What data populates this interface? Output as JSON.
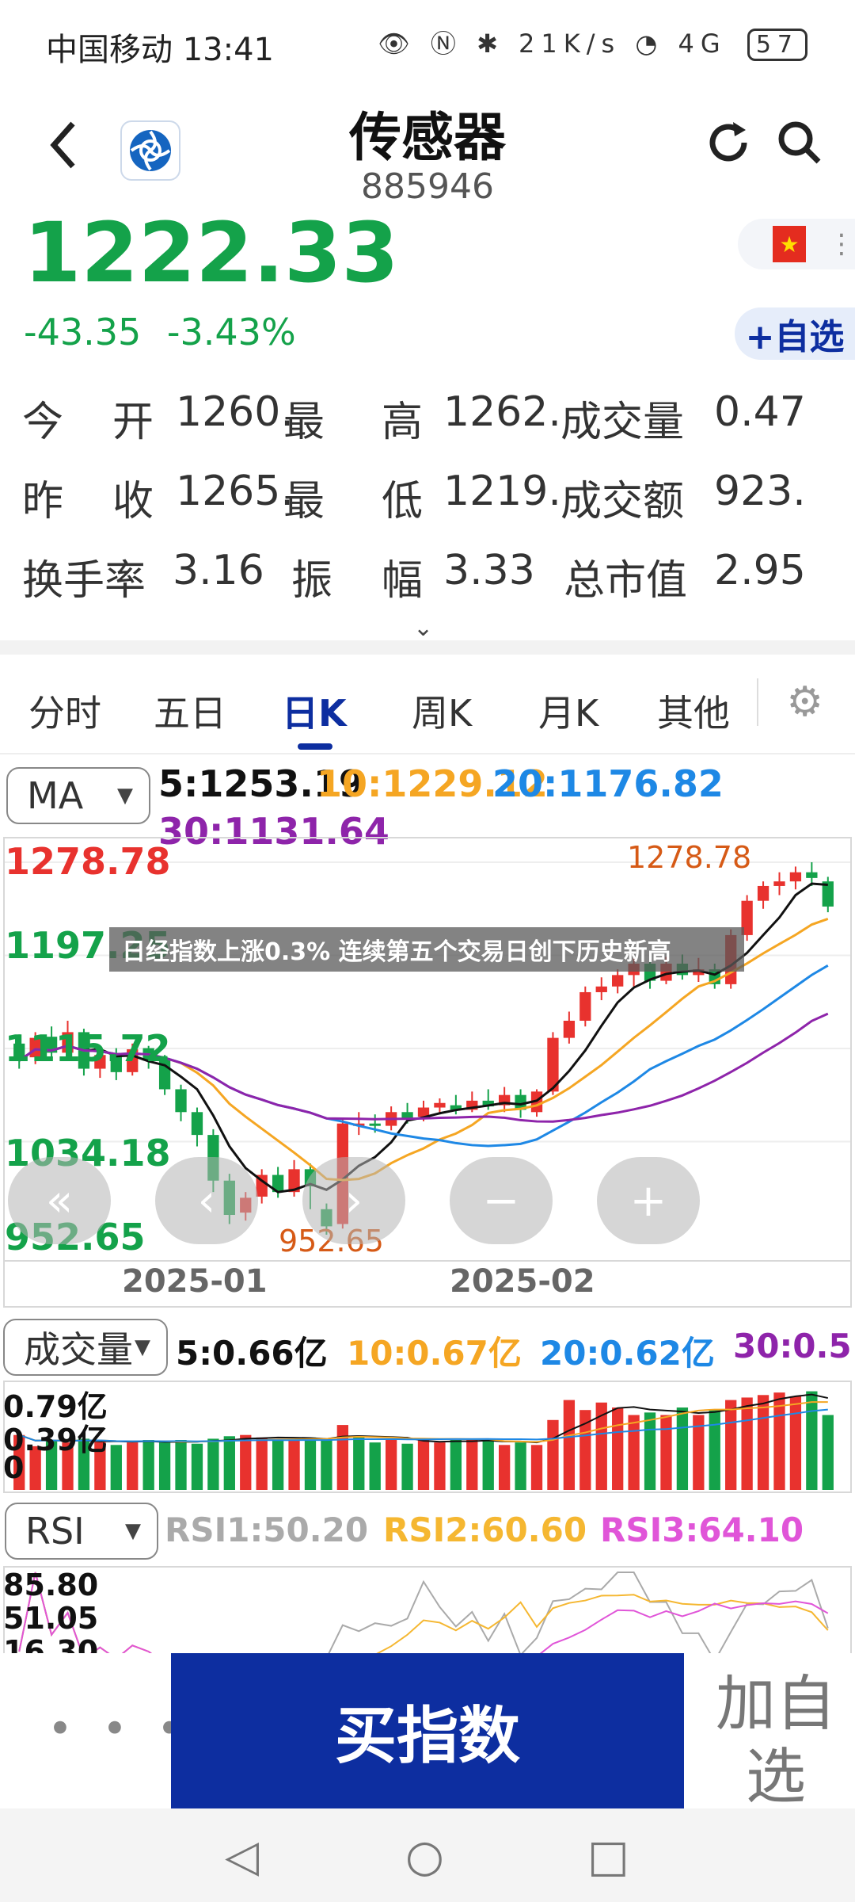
{
  "status": {
    "carrier_time": "中国移动 13:41",
    "icons": "👁 Ⓝ ✱ 21K/s ◔ 4G",
    "battery": "57"
  },
  "header": {
    "title": "传感器",
    "code": "885946",
    "back_icon": "chevron-left",
    "refresh_icon": "refresh",
    "search_icon": "search"
  },
  "quote": {
    "price": "1222.33",
    "change": "-43.35",
    "change_pct": "-3.43%",
    "add_watch": "+自选"
  },
  "stats": {
    "rows": [
      [
        "今",
        "开",
        "1260.",
        "最",
        "高",
        "1262.",
        "成交量",
        "0.47"
      ],
      [
        "昨",
        "收",
        "1265.",
        "最",
        "低",
        "1219.",
        "成交额",
        "923."
      ],
      [
        "换手率",
        "",
        "3.16",
        "振",
        "幅",
        "3.33",
        "总市值",
        "2.95"
      ]
    ]
  },
  "tabs": [
    "分时",
    "五日",
    "日K",
    "周K",
    "月K",
    "其他"
  ],
  "active_tab": "日K",
  "ma": {
    "selector": "MA",
    "ma5": "5:1253.19",
    "ma10": "10:1229.12",
    "ma20": "20:1176.82",
    "ma30": "30:1131.64"
  },
  "price_axis": {
    "p1": "1278.78",
    "p2": "1197.25",
    "p3": "1115.72",
    "p4": "1034.18",
    "p5": "952.65",
    "high_mark": "1278.78",
    "low_mark": "952.65"
  },
  "dates": {
    "d1": "2025-01",
    "d2": "2025-02"
  },
  "news_banner": "日经指数上涨0.3% 连续第五个交易日创下历史新高",
  "volume": {
    "selector": "成交量",
    "v5": "5:0.66亿",
    "v10": "10:0.67亿",
    "v20": "20:0.62亿",
    "v30": "30:0.5",
    "ax1": "0.79亿",
    "ax2": "0.39亿",
    "ax3": "0"
  },
  "rsi": {
    "selector": "RSI",
    "rsi1": "RSI1:50.20",
    "rsi2": "RSI2:60.60",
    "rsi3": "RSI3:64.10",
    "ax1": "85.80",
    "ax2": "51.05",
    "ax3": "16.30"
  },
  "bottom": {
    "more": "• • •",
    "buy": "买指数",
    "add": "加自选"
  },
  "colors": {
    "up": "#e8322e",
    "down": "#14a24a",
    "ma5": "#111111",
    "ma10": "#f5a623",
    "ma20": "#1e88e5",
    "ma30": "#8e24aa",
    "brand": "#0d2ea0"
  },
  "chart_data": {
    "type": "candlestick",
    "ylim": [
      952.65,
      1278.78
    ],
    "candles": [
      [
        1120,
        1105,
        1128,
        1098
      ],
      [
        1108,
        1125,
        1130,
        1102
      ],
      [
        1126,
        1112,
        1135,
        1108
      ],
      [
        1112,
        1130,
        1140,
        1106
      ],
      [
        1130,
        1098,
        1133,
        1092
      ],
      [
        1098,
        1110,
        1115,
        1090
      ],
      [
        1110,
        1095,
        1116,
        1088
      ],
      [
        1095,
        1115,
        1120,
        1092
      ],
      [
        1116,
        1105,
        1118,
        1098
      ],
      [
        1106,
        1080,
        1110,
        1075
      ],
      [
        1080,
        1060,
        1084,
        1052
      ],
      [
        1060,
        1040,
        1064,
        1030
      ],
      [
        1040,
        1000,
        1045,
        990
      ],
      [
        1000,
        970,
        1006,
        962
      ],
      [
        972,
        985,
        990,
        965
      ],
      [
        986,
        1005,
        1010,
        980
      ],
      [
        1005,
        990,
        1012,
        985
      ],
      [
        990,
        1010,
        1018,
        986
      ],
      [
        1010,
        995,
        1015,
        975
      ],
      [
        975,
        960,
        980,
        952.65
      ],
      [
        962,
        1050,
        1055,
        958
      ],
      [
        1050,
        1050,
        1060,
        1040
      ],
      [
        1050,
        1048,
        1058,
        1042
      ],
      [
        1048,
        1060,
        1065,
        1044
      ],
      [
        1060,
        1055,
        1068,
        1050
      ],
      [
        1056,
        1064,
        1070,
        1052
      ],
      [
        1064,
        1068,
        1072,
        1058
      ],
      [
        1066,
        1062,
        1075,
        1058
      ],
      [
        1062,
        1070,
        1078,
        1060
      ],
      [
        1070,
        1065,
        1080,
        1062
      ],
      [
        1066,
        1075,
        1082,
        1060
      ],
      [
        1075,
        1062,
        1080,
        1055
      ],
      [
        1060,
        1078,
        1080,
        1056
      ],
      [
        1078,
        1125,
        1130,
        1075
      ],
      [
        1125,
        1140,
        1148,
        1120
      ],
      [
        1140,
        1165,
        1170,
        1135
      ],
      [
        1165,
        1170,
        1178,
        1158
      ],
      [
        1170,
        1180,
        1185,
        1164
      ],
      [
        1180,
        1190,
        1196,
        1170
      ],
      [
        1190,
        1175,
        1197,
        1168
      ],
      [
        1175,
        1190,
        1196,
        1172
      ],
      [
        1190,
        1180,
        1198,
        1176
      ],
      [
        1180,
        1185,
        1195,
        1174
      ],
      [
        1185,
        1172,
        1190,
        1168
      ],
      [
        1172,
        1215,
        1220,
        1168
      ],
      [
        1215,
        1245,
        1250,
        1210
      ],
      [
        1245,
        1258,
        1262,
        1238
      ],
      [
        1258,
        1262,
        1270,
        1250
      ],
      [
        1262,
        1270,
        1275,
        1255
      ],
      [
        1270,
        1265,
        1278.78,
        1258
      ],
      [
        1262,
        1240,
        1266,
        1235
      ]
    ],
    "volume": [
      0.44,
      0.35,
      0.4,
      0.38,
      0.41,
      0.4,
      0.36,
      0.38,
      0.4,
      0.38,
      0.4,
      0.37,
      0.41,
      0.43,
      0.44,
      0.42,
      0.4,
      0.4,
      0.42,
      0.4,
      0.52,
      0.42,
      0.38,
      0.4,
      0.37,
      0.4,
      0.38,
      0.4,
      0.4,
      0.4,
      0.36,
      0.38,
      0.36,
      0.56,
      0.72,
      0.64,
      0.7,
      0.66,
      0.6,
      0.62,
      0.6,
      0.66,
      0.6,
      0.64,
      0.72,
      0.74,
      0.76,
      0.78,
      0.75,
      0.79,
      0.6
    ],
    "volume_up": [
      true,
      true,
      false,
      true,
      false,
      true,
      false,
      true,
      false,
      false,
      false,
      false,
      false,
      false,
      true,
      true,
      false,
      true,
      false,
      false,
      true,
      false,
      false,
      true,
      false,
      true,
      true,
      false,
      true,
      false,
      true,
      false,
      true,
      true,
      true,
      true,
      true,
      true,
      true,
      false,
      true,
      false,
      true,
      false,
      true,
      true,
      true,
      true,
      true,
      false,
      false
    ]
  }
}
